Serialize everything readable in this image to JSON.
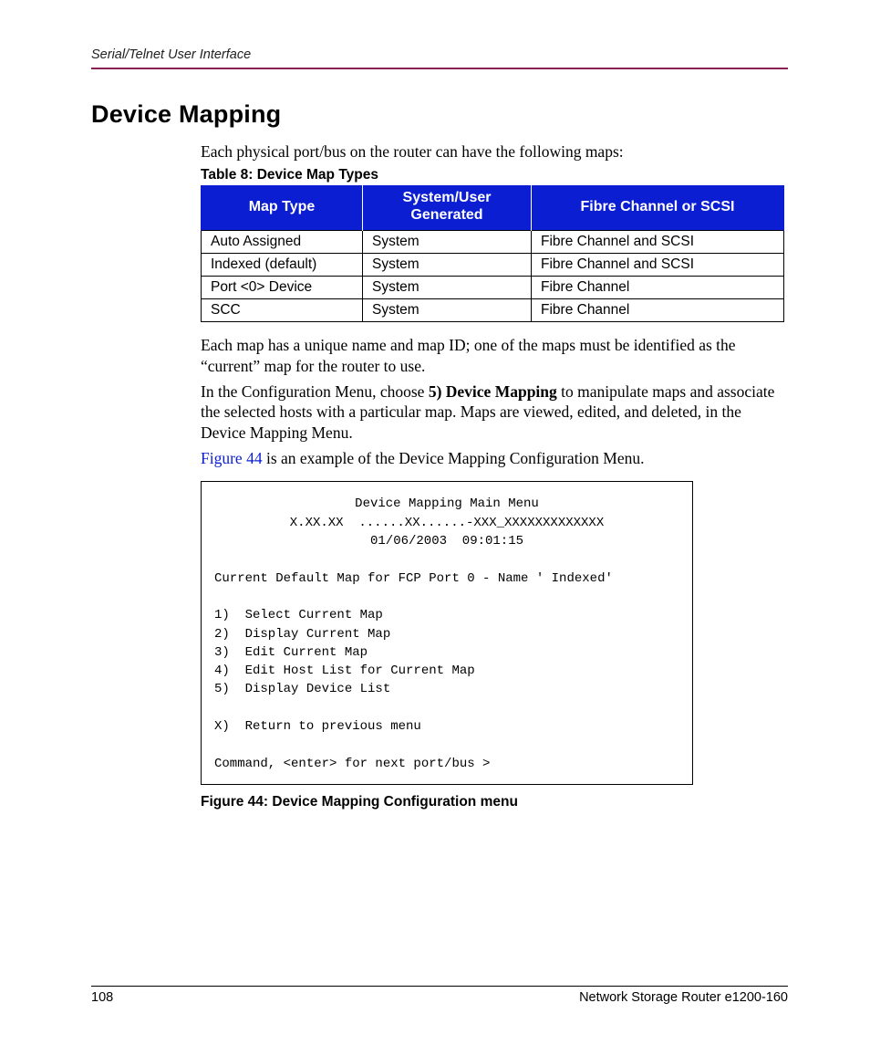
{
  "header": {
    "running": "Serial/Telnet User Interface"
  },
  "title": "Device Mapping",
  "intro": "Each physical port/bus on the router can have the following maps:",
  "table": {
    "caption": "Table 8:  Device Map Types",
    "headers": {
      "c1": "Map Type",
      "c2_l1": "System/User",
      "c2_l2": "Generated",
      "c3": "Fibre Channel or SCSI"
    },
    "rows": [
      {
        "c1": "Auto Assigned",
        "c2": "System",
        "c3": "Fibre Channel and SCSI"
      },
      {
        "c1": "Indexed (default)",
        "c2": "System",
        "c3": "Fibre Channel and SCSI"
      },
      {
        "c1": "Port <0> Device",
        "c2": "System",
        "c3": "Fibre Channel"
      },
      {
        "c1": "SCC",
        "c2": "System",
        "c3": "Fibre Channel"
      }
    ]
  },
  "para2": "Each map has a unique name and map ID; one of the maps must be identified as the “current” map for the router to use.",
  "para3_pre": "In the Configuration Menu, choose ",
  "para3_bold": "5) Device Mapping",
  "para3_post": " to manipulate maps and associate the selected hosts with a particular map. Maps are viewed, edited, and deleted, in the Device Mapping Menu.",
  "para4_link": "Figure 44",
  "para4_rest": " is an example of the Device Mapping Configuration Menu.",
  "figure": {
    "title": "Device Mapping Main Menu",
    "ident": "X.XX.XX  ......XX......-XXX_XXXXXXXXXXXXX",
    "datetime": "01/06/2003  09:01:15",
    "current": "Current Default Map for FCP Port 0 - Name ' Indexed'",
    "opt1": "1)  Select Current Map",
    "opt2": "2)  Display Current Map",
    "opt3": "3)  Edit Current Map",
    "opt4": "4)  Edit Host List for Current Map",
    "opt5": "5)  Display Device List",
    "optX": "X)  Return to previous menu",
    "prompt": "Command, <enter> for next port/bus >",
    "caption": "Figure 44:  Device Mapping Configuration menu"
  },
  "footer": {
    "page": "108",
    "doc": "Network Storage Router e1200-160"
  }
}
